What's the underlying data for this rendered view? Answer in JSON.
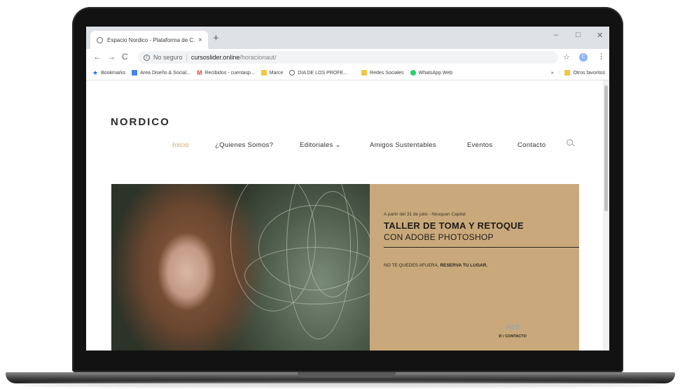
{
  "browser": {
    "tab_title": "Espacio Nordico - Plataforma de C…",
    "tab_close": "×",
    "new_tab": "+",
    "window_controls": [
      "–",
      "□",
      "✕"
    ],
    "nav": {
      "back": "←",
      "forward": "→",
      "reload": "C"
    },
    "address": {
      "security": "No seguro",
      "host": "cursoslider.online",
      "path": "/horacionaut/"
    },
    "profile_initial": "C"
  },
  "bookmarks": {
    "items": [
      {
        "label": "Bookmarks",
        "icon": "star-icon",
        "color": "#1a73e8"
      },
      {
        "label": "Area Diseño & Social...",
        "icon": "docs-icon",
        "color": "#4285f4"
      },
      {
        "label": "Recibidos - cuentasp...",
        "icon": "gmail-icon",
        "color": "#ea4335"
      },
      {
        "label": "Marce",
        "icon": "folder-icon",
        "color": "#f4c542"
      },
      {
        "label": "DIA DE LOS PROFE...",
        "icon": "globe-icon",
        "color": "#5f6368"
      },
      {
        "label": "Redes Sociales",
        "icon": "folder-icon",
        "color": "#f4c542"
      },
      {
        "label": "WhatsApp Web",
        "icon": "whatsapp-icon",
        "color": "#25d366"
      }
    ],
    "overflow": "»",
    "other": "Otros favoritos"
  },
  "site": {
    "logo": "NORDICO",
    "menu": [
      {
        "label": "Inicio",
        "active": true
      },
      {
        "label": "¿Quienes Somos?"
      },
      {
        "label": "Editoriales ⌄"
      },
      {
        "label": "Amigos Sustentables"
      },
      {
        "label": "Eventos"
      },
      {
        "label": "Contacto"
      }
    ],
    "hero": {
      "kicker": "A partir del 31 de julio - Neuquen Capital",
      "title_bold": "TALLER DE TOMA Y RETOQUE",
      "title_light": "CON ADOBE PHOTOSHOP",
      "cta_prefix": "NO TE QUEDES AFUERA,",
      "cta_bold": "RESERVA TU LUGAR.",
      "contact": "✆ / CONTACTO"
    }
  },
  "watermark": "Acti",
  "colors": {
    "accent": "#c9a46b",
    "panel": "#c9a97c",
    "frame": "#121212"
  }
}
